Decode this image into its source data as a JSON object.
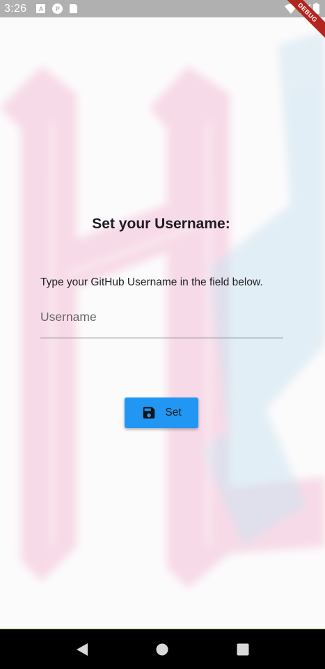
{
  "status_bar": {
    "time": "3:26",
    "icons": [
      "a-icon",
      "privacy-icon",
      "sd-card-icon",
      "wifi-icon",
      "signal-icon",
      "battery-icon"
    ]
  },
  "debug_banner": {
    "label": "DEBUG"
  },
  "main": {
    "title": "Set your Username:",
    "instruction": "Type your GitHub Username in the field below.",
    "username_field": {
      "placeholder": "Username",
      "value": ""
    },
    "set_button": {
      "label": "Set",
      "icon": "save-icon",
      "color": "#2196f3"
    }
  },
  "nav_bar": {
    "buttons": [
      "back-icon",
      "home-icon",
      "recents-icon"
    ]
  }
}
